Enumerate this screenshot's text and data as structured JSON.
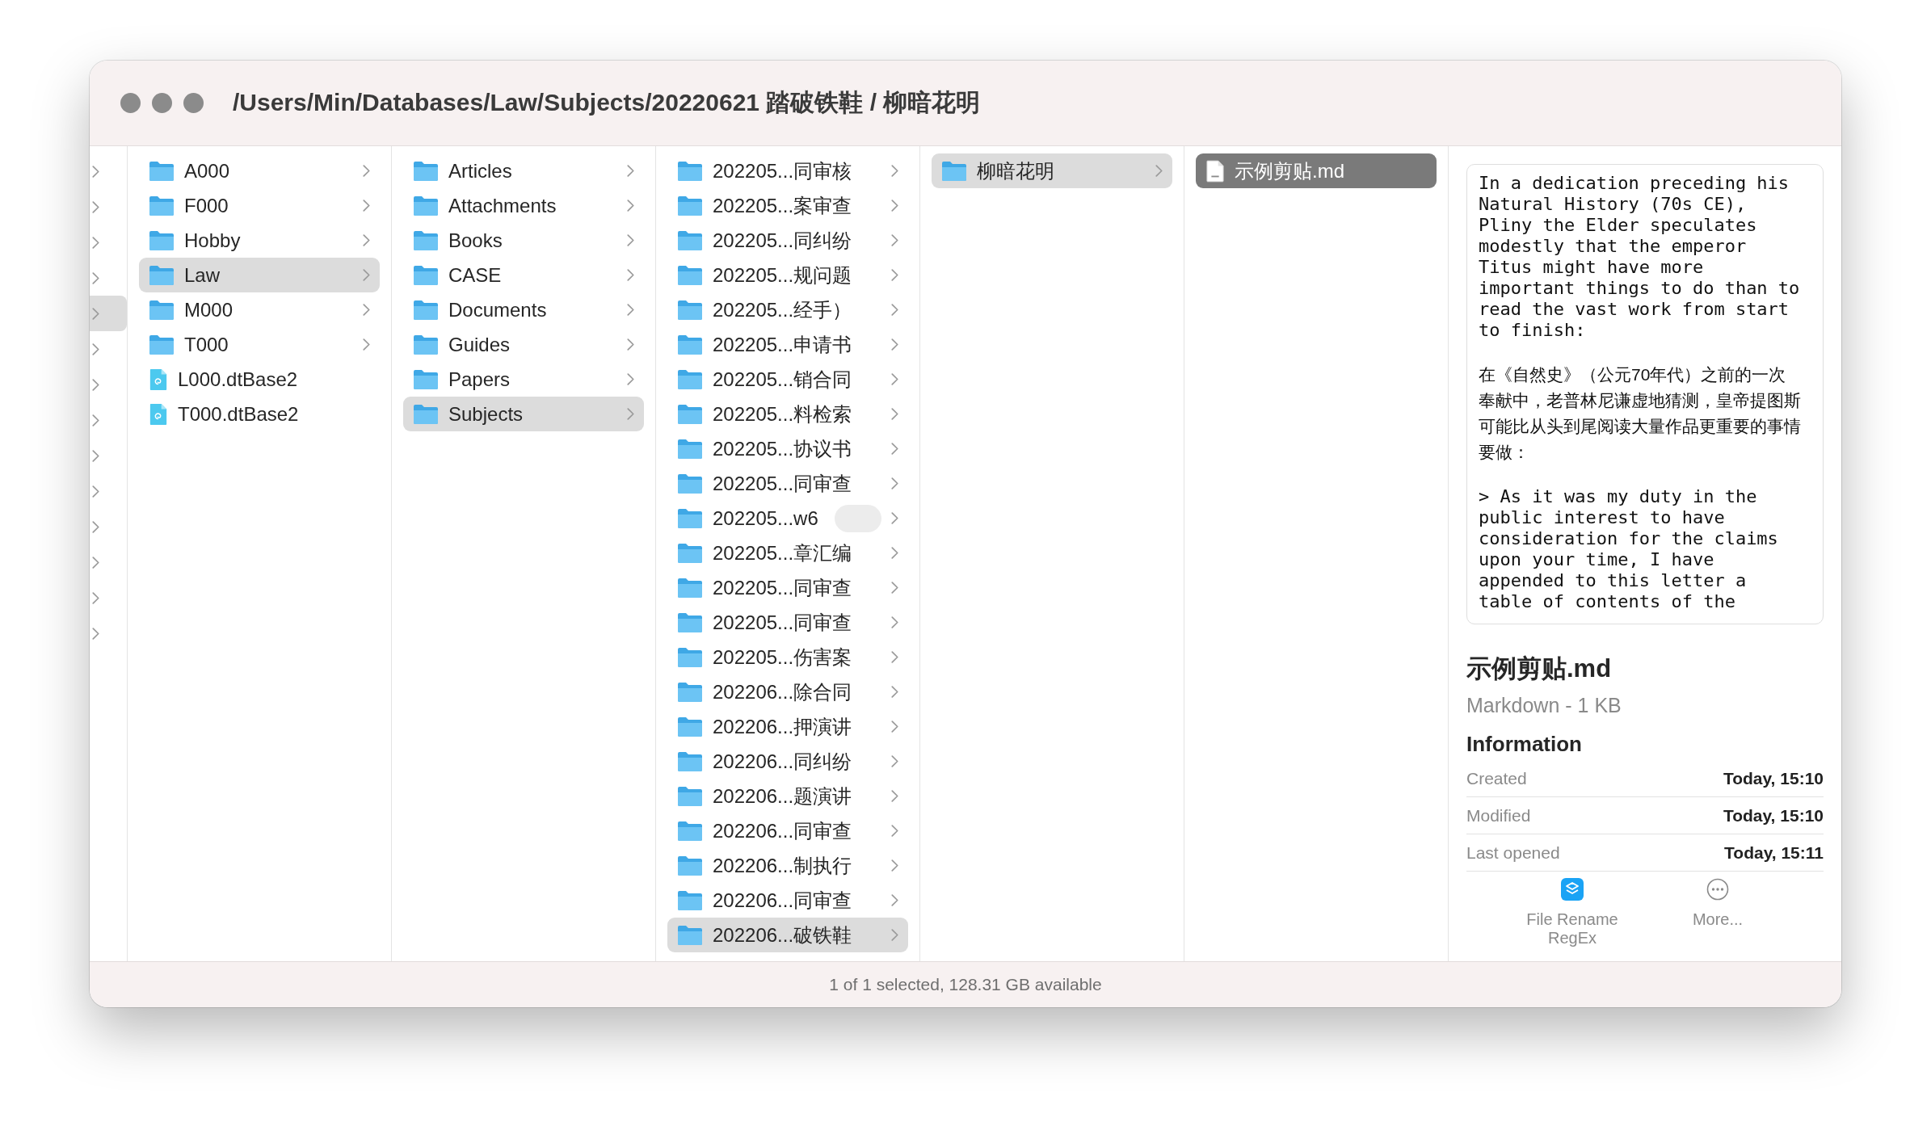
{
  "window": {
    "title": "/Users/Min/Databases/Law/Subjects/20220621 踏破铁鞋 / 柳暗花明"
  },
  "parent_strip": {
    "rows": [
      {
        "selected": false
      },
      {
        "selected": false
      },
      {
        "selected": false
      },
      {
        "selected": false
      },
      {
        "selected": true
      },
      {
        "selected": false
      },
      {
        "selected": false
      },
      {
        "selected": false
      },
      {
        "selected": false
      },
      {
        "selected": false
      },
      {
        "selected": false
      },
      {
        "selected": false
      },
      {
        "selected": false
      },
      {
        "selected": false
      }
    ]
  },
  "columns": [
    {
      "focused": false,
      "items": [
        {
          "name": "A000",
          "kind": "folder",
          "selected": false,
          "tagged": false
        },
        {
          "name": "F000",
          "kind": "folder",
          "selected": false,
          "tagged": false
        },
        {
          "name": "Hobby",
          "kind": "folder",
          "selected": false,
          "tagged": false
        },
        {
          "name": "Law",
          "kind": "folder",
          "selected": true,
          "tagged": false
        },
        {
          "name": "M000",
          "kind": "folder",
          "selected": false,
          "tagged": false
        },
        {
          "name": "T000",
          "kind": "folder",
          "selected": false,
          "tagged": false
        },
        {
          "name": "L000.dtBase2",
          "kind": "database",
          "selected": false,
          "tagged": false
        },
        {
          "name": "T000.dtBase2",
          "kind": "database",
          "selected": false,
          "tagged": false
        }
      ]
    },
    {
      "focused": false,
      "items": [
        {
          "name": "Articles",
          "kind": "folder",
          "selected": false,
          "tagged": false
        },
        {
          "name": "Attachments",
          "kind": "folder",
          "selected": false,
          "tagged": false
        },
        {
          "name": "Books",
          "kind": "folder",
          "selected": false,
          "tagged": false
        },
        {
          "name": "CASE",
          "kind": "folder",
          "selected": false,
          "tagged": false
        },
        {
          "name": "Documents",
          "kind": "folder",
          "selected": false,
          "tagged": false
        },
        {
          "name": "Guides",
          "kind": "folder",
          "selected": false,
          "tagged": false
        },
        {
          "name": "Papers",
          "kind": "folder",
          "selected": false,
          "tagged": false
        },
        {
          "name": "Subjects",
          "kind": "folder",
          "selected": true,
          "tagged": false
        }
      ]
    },
    {
      "focused": false,
      "items": [
        {
          "name": "202205...同审核",
          "kind": "folder",
          "selected": false,
          "tagged": false
        },
        {
          "name": "202205...案审查",
          "kind": "folder",
          "selected": false,
          "tagged": false
        },
        {
          "name": "202205...同纠纷",
          "kind": "folder",
          "selected": false,
          "tagged": false
        },
        {
          "name": "202205...规问题",
          "kind": "folder",
          "selected": false,
          "tagged": false
        },
        {
          "name": "202205...经手）",
          "kind": "folder",
          "selected": false,
          "tagged": false
        },
        {
          "name": "202205...申请书",
          "kind": "folder",
          "selected": false,
          "tagged": false
        },
        {
          "name": "202205...销合同",
          "kind": "folder",
          "selected": false,
          "tagged": false
        },
        {
          "name": "202205...料检索",
          "kind": "folder",
          "selected": false,
          "tagged": false
        },
        {
          "name": "202205...协议书",
          "kind": "folder",
          "selected": false,
          "tagged": false
        },
        {
          "name": "202205...同审查",
          "kind": "folder",
          "selected": false,
          "tagged": false
        },
        {
          "name": "202205...w6",
          "kind": "folder",
          "selected": false,
          "tagged": true
        },
        {
          "name": "202205...章汇编",
          "kind": "folder",
          "selected": false,
          "tagged": false
        },
        {
          "name": "202205...同审查",
          "kind": "folder",
          "selected": false,
          "tagged": false
        },
        {
          "name": "202205...同审查",
          "kind": "folder",
          "selected": false,
          "tagged": false
        },
        {
          "name": "202205...伤害案",
          "kind": "folder",
          "selected": false,
          "tagged": false
        },
        {
          "name": "202206...除合同",
          "kind": "folder",
          "selected": false,
          "tagged": false
        },
        {
          "name": "202206...押演讲",
          "kind": "folder",
          "selected": false,
          "tagged": false
        },
        {
          "name": "202206...同纠纷",
          "kind": "folder",
          "selected": false,
          "tagged": false
        },
        {
          "name": "202206...题演讲",
          "kind": "folder",
          "selected": false,
          "tagged": false
        },
        {
          "name": "202206...同审查",
          "kind": "folder",
          "selected": false,
          "tagged": false
        },
        {
          "name": "202206...制执行",
          "kind": "folder",
          "selected": false,
          "tagged": false
        },
        {
          "name": "202206...同审查",
          "kind": "folder",
          "selected": false,
          "tagged": false
        },
        {
          "name": "202206...破铁鞋",
          "kind": "folder",
          "selected": true,
          "tagged": false
        }
      ]
    },
    {
      "focused": false,
      "items": [
        {
          "name": "柳暗花明",
          "kind": "folder",
          "selected": true,
          "tagged": false
        }
      ]
    },
    {
      "focused": true,
      "items": [
        {
          "name": "示例剪贴.md",
          "kind": "document",
          "selected": true,
          "tagged": false
        }
      ]
    }
  ],
  "preview": {
    "paragraphs": [
      {
        "text": "In a dedication preceding his Natural History (70s CE), Pliny the Elder speculates modestly that the emperor Titus might have more important things to do than to read the vast work from start to finish:",
        "kind": "mono"
      },
      {
        "text": "在《自然史》（公元70年代）之前的一次奉献中，老普林尼谦虚地猜测，皇帝提图斯可能比从头到尾阅读大量作品更重要的事情要做：",
        "kind": "cjk"
      },
      {
        "text": "> As it was my duty in the public interest to have consideration for the claims upon your time, I have appended to this letter a table of contents of the",
        "kind": "mono"
      }
    ],
    "file_name": "示例剪贴.md",
    "file_type": "Markdown - 1 KB",
    "info_heading": "Information",
    "info": [
      {
        "label": "Created",
        "value": "Today, 15:10"
      },
      {
        "label": "Modified",
        "value": "Today, 15:10"
      },
      {
        "label": "Last opened",
        "value": "Today, 15:11"
      }
    ],
    "actions": [
      {
        "label": "File Rename RegEx",
        "kind": "shortcut"
      },
      {
        "label": "More...",
        "kind": "more"
      }
    ]
  },
  "status_bar": "1 of 1 selected, 128.31 GB available"
}
